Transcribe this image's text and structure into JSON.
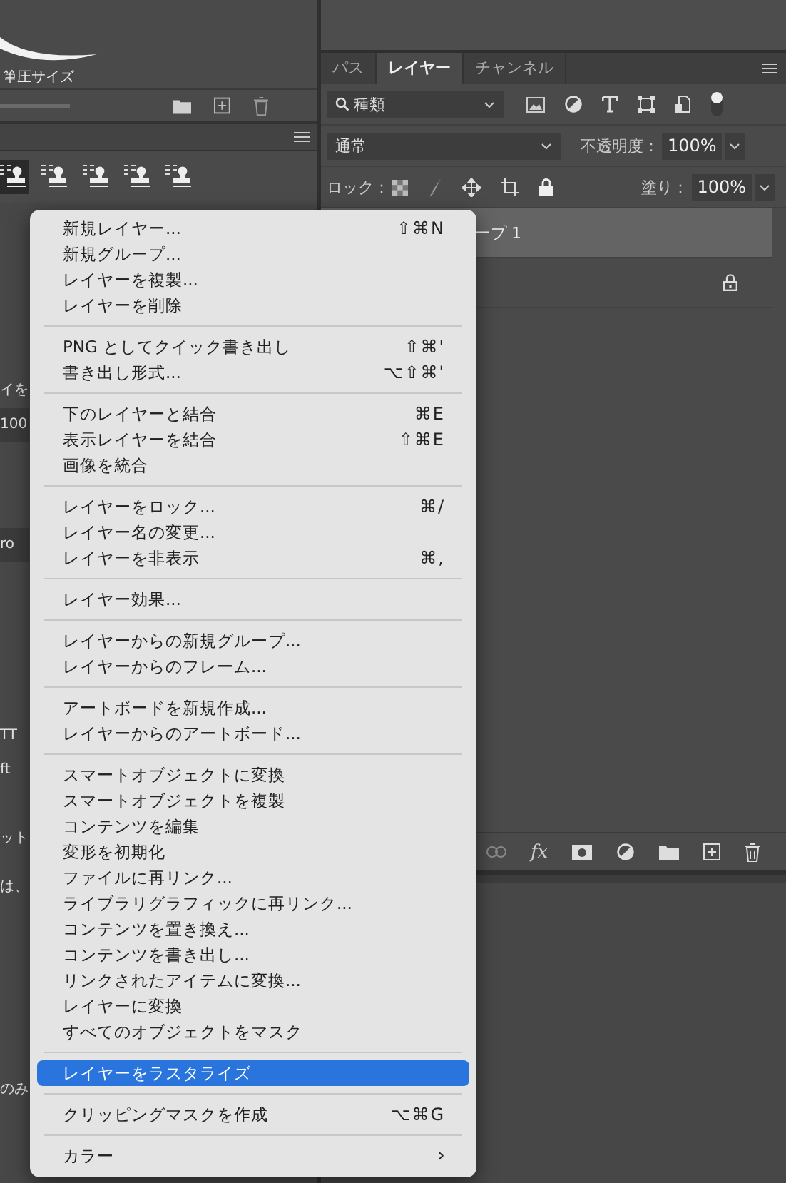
{
  "brush_panel": {
    "label": "筆圧サイズ"
  },
  "tool_presets": [
    {
      "selected": true
    },
    {
      "selected": false
    },
    {
      "selected": false
    },
    {
      "selected": false
    },
    {
      "selected": false
    }
  ],
  "left_fragments": [
    {
      "kind": "label",
      "text": "イを"
    },
    {
      "kind": "field",
      "text": "100"
    },
    {
      "kind": "field",
      "text": "ro"
    },
    {
      "kind": "label",
      "text": "TT"
    },
    {
      "kind": "label",
      "text": "ft"
    },
    {
      "kind": "label",
      "text": "ット"
    },
    {
      "kind": "label",
      "text": "は、"
    },
    {
      "kind": "label",
      "text": "のみ"
    }
  ],
  "tabs": [
    {
      "label": "パス",
      "selected": false
    },
    {
      "label": "レイヤー",
      "selected": true
    },
    {
      "label": "チャンネル",
      "selected": false
    }
  ],
  "filter": {
    "value": "種類"
  },
  "blend_mode": {
    "value": "通常"
  },
  "opacity": {
    "label": "不透明度：",
    "value": "100%"
  },
  "lock": {
    "label": "ロック："
  },
  "fill": {
    "label": "塗り：",
    "value": "100%"
  },
  "layers": [
    {
      "name": "ープ 1",
      "selected": true,
      "locked": false
    },
    {
      "selected": false,
      "locked": true
    }
  ],
  "layer_toolbar": {
    "fx": "fx"
  },
  "menu": {
    "groups": [
      {
        "items": [
          {
            "label": "新規レイヤー...",
            "shortcut": "⇧⌘N",
            "selected": false
          },
          {
            "label": "新規グループ...",
            "selected": false
          },
          {
            "label": "レイヤーを複製...",
            "selected": false
          },
          {
            "label": "レイヤーを削除",
            "selected": false
          }
        ]
      },
      {
        "items": [
          {
            "label": "PNG としてクイック書き出し",
            "shortcut": "⇧⌘'",
            "selected": false
          },
          {
            "label": "書き出し形式...",
            "shortcut": "⌥⇧⌘'",
            "selected": false
          }
        ]
      },
      {
        "items": [
          {
            "label": "下のレイヤーと結合",
            "shortcut": "⌘E",
            "selected": false
          },
          {
            "label": "表示レイヤーを結合",
            "shortcut": "⇧⌘E",
            "selected": false
          },
          {
            "label": "画像を統合",
            "selected": false
          }
        ]
      },
      {
        "items": [
          {
            "label": "レイヤーをロック...",
            "shortcut": "⌘/",
            "selected": false
          },
          {
            "label": "レイヤー名の変更...",
            "selected": false
          },
          {
            "label": "レイヤーを非表示",
            "shortcut": "⌘,",
            "selected": false
          }
        ]
      },
      {
        "items": [
          {
            "label": "レイヤー効果...",
            "selected": false
          }
        ]
      },
      {
        "items": [
          {
            "label": "レイヤーからの新規グループ...",
            "selected": false
          },
          {
            "label": "レイヤーからのフレーム...",
            "selected": false
          }
        ]
      },
      {
        "items": [
          {
            "label": "アートボードを新規作成...",
            "selected": false
          },
          {
            "label": "レイヤーからのアートボード...",
            "selected": false
          }
        ]
      },
      {
        "items": [
          {
            "label": "スマートオブジェクトに変換",
            "selected": false
          },
          {
            "label": "スマートオブジェクトを複製",
            "selected": false
          },
          {
            "label": "コンテンツを編集",
            "selected": false
          },
          {
            "label": "変形を初期化",
            "selected": false
          },
          {
            "label": "ファイルに再リンク...",
            "selected": false
          },
          {
            "label": "ライブラリグラフィックに再リンク...",
            "selected": false
          },
          {
            "label": "コンテンツを置き換え...",
            "selected": false
          },
          {
            "label": "コンテンツを書き出し...",
            "selected": false
          },
          {
            "label": "リンクされたアイテムに変換...",
            "selected": false
          },
          {
            "label": "レイヤーに変換",
            "selected": false
          },
          {
            "label": "すべてのオブジェクトをマスク",
            "selected": false
          }
        ]
      },
      {
        "items": [
          {
            "label": "レイヤーをラスタライズ",
            "selected": true
          }
        ]
      },
      {
        "items": [
          {
            "label": "クリッピングマスクを作成",
            "shortcut": "⌥⌘G",
            "selected": false
          }
        ]
      },
      {
        "items": [
          {
            "label": "カラー",
            "submenu_arrow": "›",
            "selected": false
          }
        ]
      }
    ]
  }
}
